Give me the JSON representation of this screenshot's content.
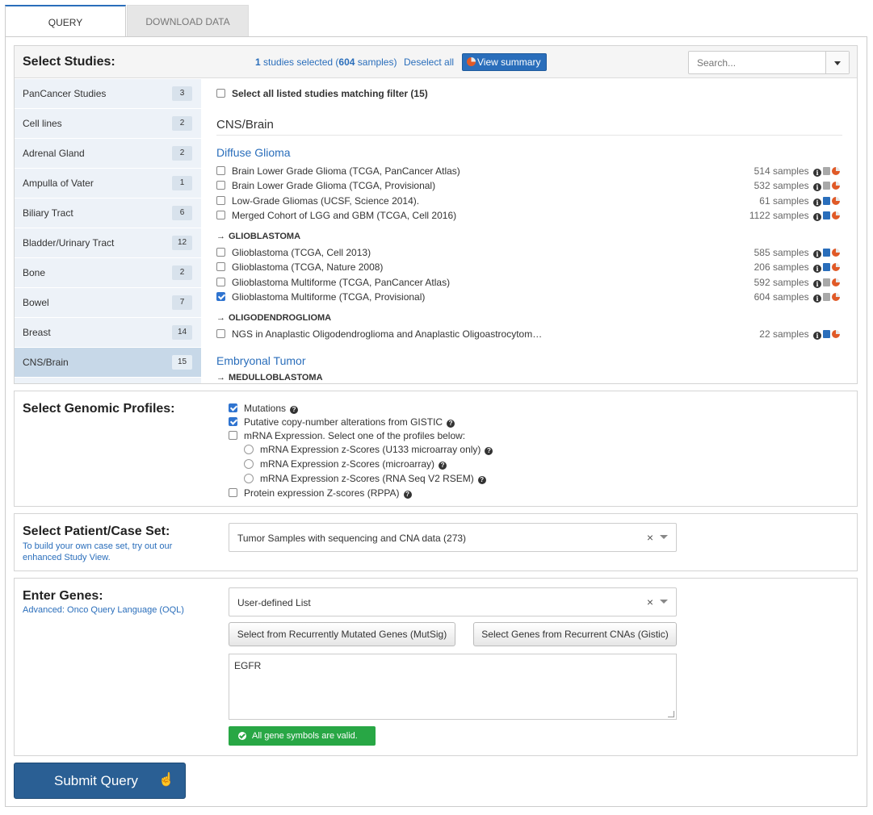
{
  "tabs": [
    "QUERY",
    "DOWNLOAD DATA"
  ],
  "studies": {
    "title": "Select Studies:",
    "selected_count": "1",
    "selected_text_mid": " studies selected (",
    "selected_samples": "604",
    "selected_text_end": " samples)",
    "deselect_label": "Deselect all",
    "view_summary_label": "View summary",
    "search_placeholder": "Search...",
    "categories": [
      {
        "label": "PanCancer Studies",
        "count": "3"
      },
      {
        "label": "Cell lines",
        "count": "2"
      },
      {
        "label": "Adrenal Gland",
        "count": "2"
      },
      {
        "label": "Ampulla of Vater",
        "count": "1"
      },
      {
        "label": "Biliary Tract",
        "count": "6"
      },
      {
        "label": "Bladder/Urinary Tract",
        "count": "12"
      },
      {
        "label": "Bone",
        "count": "2"
      },
      {
        "label": "Bowel",
        "count": "7"
      },
      {
        "label": "Breast",
        "count": "14"
      },
      {
        "label": "CNS/Brain",
        "count": "15"
      }
    ],
    "active_category": "CNS/Brain",
    "select_all_label": "Select all listed studies matching filter (15)",
    "organ_title": "CNS/Brain",
    "groups": {
      "diffuse_glioma": "Diffuse Glioma",
      "glioblastoma": "GLIOBLASTOMA",
      "oligodendroglioma": "OLIGODENDROGLIOMA",
      "embryonal_tumor": "Embryonal Tumor",
      "medulloblastoma": "MEDULLOBLASTOMA"
    },
    "rows": [
      {
        "name": "Brain Lower Grade Glioma (TCGA, PanCancer Atlas)",
        "samples": "514 samples",
        "checked": false,
        "book": "grey"
      },
      {
        "name": "Brain Lower Grade Glioma (TCGA, Provisional)",
        "samples": "532 samples",
        "checked": false,
        "book": "grey"
      },
      {
        "name": "Low-Grade Gliomas (UCSF, Science 2014).",
        "samples": "61 samples",
        "checked": false,
        "book": "blue"
      },
      {
        "name": "Merged Cohort of LGG and GBM (TCGA, Cell 2016)",
        "samples": "1122 samples",
        "checked": false,
        "book": "blue"
      },
      {
        "name": "Glioblastoma (TCGA, Cell 2013)",
        "samples": "585 samples",
        "checked": false,
        "book": "blue"
      },
      {
        "name": "Glioblastoma (TCGA, Nature 2008)",
        "samples": "206 samples",
        "checked": false,
        "book": "blue"
      },
      {
        "name": "Glioblastoma Multiforme (TCGA, PanCancer Atlas)",
        "samples": "592 samples",
        "checked": false,
        "book": "grey"
      },
      {
        "name": "Glioblastoma Multiforme (TCGA, Provisional)",
        "samples": "604 samples",
        "checked": true,
        "book": "grey"
      },
      {
        "name": "NGS in Anaplastic Oligodendroglioma and Anaplastic Oligoastrocytom…",
        "samples": "22 samples",
        "checked": false,
        "book": "blue"
      }
    ]
  },
  "profiles": {
    "title": "Select Genomic Profiles:",
    "mutations": "Mutations",
    "cna": "Putative copy-number alterations from GISTIC",
    "mrna": "mRNA Expression. Select one of the profiles below:",
    "mrna_u133": "mRNA Expression z-Scores (U133 microarray only)",
    "mrna_micro": "mRNA Expression z-Scores (microarray)",
    "mrna_rnaseq": "mRNA Expression z-Scores (RNA Seq V2 RSEM)",
    "protein": "Protein expression Z-scores (RPPA)"
  },
  "caseset": {
    "title": "Select Patient/Case Set:",
    "link_line1": "To build your own case set, try out our",
    "link_line2": "enhanced Study View.",
    "value": "Tumor Samples with sequencing and CNA data (273)"
  },
  "genes": {
    "title": "Enter Genes:",
    "oql_link": "Advanced: Onco Query Language (OQL)",
    "list_value": "User-defined List",
    "mutsig_button": "Select from Recurrently Mutated Genes (MutSig)",
    "gistic_button": "Select Genes from Recurrent CNAs (Gistic)",
    "text": "EGFR",
    "valid_message": "All gene symbols are valid."
  },
  "submit_label": "Submit Query",
  "icons": [
    "info-icon",
    "book-icon",
    "pie-chart-icon",
    "help-icon",
    "check-circle-icon",
    "close-icon",
    "chevron-down-icon",
    "hand-cursor-icon"
  ]
}
